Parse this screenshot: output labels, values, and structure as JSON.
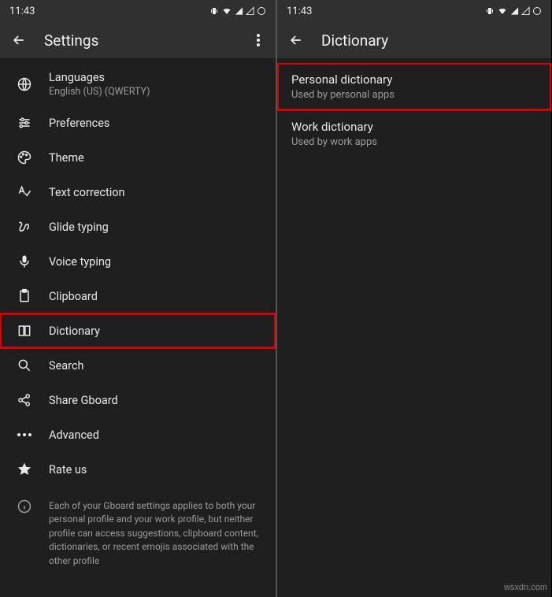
{
  "statusbar": {
    "time": "11:43"
  },
  "left": {
    "title": "Settings",
    "items": [
      {
        "icon": "globe-icon",
        "label": "Languages",
        "sub": "English (US) (QWERTY)"
      },
      {
        "icon": "sliders-icon",
        "label": "Preferences"
      },
      {
        "icon": "palette-icon",
        "label": "Theme"
      },
      {
        "icon": "spellcheck-icon",
        "label": "Text correction"
      },
      {
        "icon": "gesture-icon",
        "label": "Glide typing"
      },
      {
        "icon": "mic-icon",
        "label": "Voice typing"
      },
      {
        "icon": "clipboard-icon",
        "label": "Clipboard"
      },
      {
        "icon": "book-icon",
        "label": "Dictionary",
        "highlight": true
      },
      {
        "icon": "search-icon",
        "label": "Search"
      },
      {
        "icon": "share-icon",
        "label": "Share Gboard"
      },
      {
        "icon": "more-horiz-icon",
        "label": "Advanced"
      },
      {
        "icon": "star-icon",
        "label": "Rate us"
      }
    ],
    "footer": "Each of your Gboard settings applies to both your personal profile and your work profile, but neither profile can access suggestions, clipboard content, dictionaries, or recent emojis associated with the other profile"
  },
  "right": {
    "title": "Dictionary",
    "items": [
      {
        "label": "Personal dictionary",
        "sub": "Used by personal apps",
        "highlight": true
      },
      {
        "label": "Work dictionary",
        "sub": "Used by work apps"
      }
    ]
  },
  "watermark": "wsxdn.com"
}
